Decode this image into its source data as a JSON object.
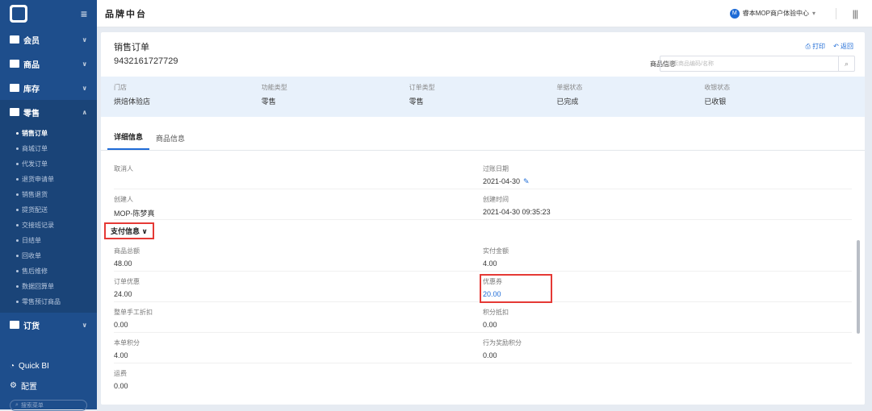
{
  "sidebar": {
    "menus": [
      {
        "label": "会员",
        "icon": "member-icon"
      },
      {
        "label": "商品",
        "icon": "goods-icon"
      },
      {
        "label": "库存",
        "icon": "inventory-icon"
      },
      {
        "label": "零售",
        "icon": "retail-icon"
      }
    ],
    "retail_sub": [
      "销售订单",
      "商城订单",
      "代发订单",
      "退货申请单",
      "销售退货",
      "提货配送",
      "交接班记录",
      "日结单",
      "回收单",
      "售后维修",
      "数据回算单",
      "零售预订商品"
    ],
    "order_menu": "订货",
    "quick_bi": "Quick BI",
    "config": "配置",
    "search_placeholder": "搜索菜单"
  },
  "topbar": {
    "title": "品牌中台",
    "avatar_letter": "M",
    "user": "睿本MOP商户体验中心",
    "grid_icon": "grid-icon"
  },
  "header": {
    "title": "销售订单",
    "order_no": "9432161727729",
    "print": "打印",
    "back": "返回",
    "search_label": "商品信息",
    "search_placeholder": "搜索商品编码/名称"
  },
  "summary": [
    {
      "label": "门店",
      "value": "烘焙体验店"
    },
    {
      "label": "功能类型",
      "value": "零售"
    },
    {
      "label": "订单类型",
      "value": "零售"
    },
    {
      "label": "单据状态",
      "value": "已完成"
    },
    {
      "label": "收银状态",
      "value": "已收银"
    }
  ],
  "tabs": [
    "详细信息",
    "商品信息"
  ],
  "details": {
    "cancel_label": "取消人",
    "cancel_value": "",
    "expire_label": "过账日期",
    "expire_value": "2021-04-30",
    "creator_label": "创建人",
    "creator_value": "MOP-陈梦真",
    "created_label": "创建时间",
    "created_value": "2021-04-30 09:35:23"
  },
  "payment": {
    "section_title": "支付信息",
    "rows": [
      {
        "l_label": "商品总额",
        "l_value": "48.00",
        "r_label": "实付金额",
        "r_value": "4.00"
      },
      {
        "l_label": "订单优惠",
        "l_value": "24.00",
        "r_label": "优惠券",
        "r_value": "20.00"
      },
      {
        "l_label": "整单手工折扣",
        "l_value": "0.00",
        "r_label": "积分抵扣",
        "r_value": "0.00"
      },
      {
        "l_label": "本单积分",
        "l_value": "4.00",
        "r_label": "行为奖励积分",
        "r_value": "0.00"
      },
      {
        "l_label": "运费",
        "l_value": "0.00",
        "r_label": "",
        "r_value": ""
      }
    ]
  },
  "colors": {
    "accent": "#1e6bd6",
    "sidebar": "#1e4e8c",
    "highlight": "#e53935"
  }
}
